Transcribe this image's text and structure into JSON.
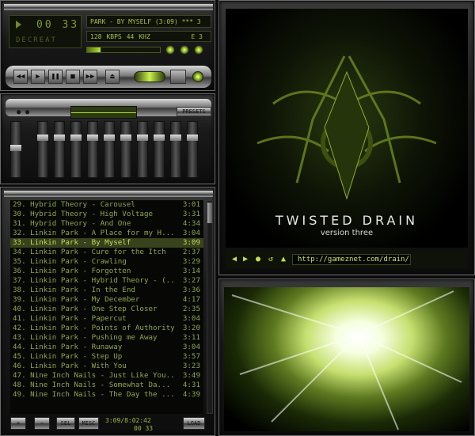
{
  "main_window": {
    "time": "00 33",
    "vis_label": "DECREAT",
    "track_title": "PARK - BY MYSELF (3:09) *** 3",
    "kbps": "128",
    "kbps_unit": "KBPS",
    "khz": "44",
    "khz_unit": "KHZ",
    "mode": "E 3",
    "seek_fraction": 0.18,
    "transport": [
      "◀◀",
      "▶",
      "❚❚",
      "■",
      "▶▶",
      "⏏"
    ]
  },
  "equalizer": {
    "onoff": "● ●",
    "presets_label": "PRESETS",
    "bands": [
      0.45,
      0.25,
      0.25,
      0.25,
      0.25,
      0.25,
      0.25,
      0.25,
      0.25,
      0.25,
      0.25
    ]
  },
  "playlist": {
    "rows": [
      {
        "title": "29. Hybrid Theory - Carousel",
        "dur": "3:01"
      },
      {
        "title": "30. Hybrid Theory - High Voltage",
        "dur": "3:31"
      },
      {
        "title": "31. Hybrid Theory - And One",
        "dur": "4:34"
      },
      {
        "title": "32. Linkin Park - A Place for my H...",
        "dur": "3:04"
      },
      {
        "title": "33. Linkin Park - By Myself",
        "dur": "3:09"
      },
      {
        "title": "34. Linkin Park - Cure for the Itch",
        "dur": "2:37"
      },
      {
        "title": "35. Linkin Park - Crawling",
        "dur": "3:29"
      },
      {
        "title": "36. Linkin Park - Forgotten",
        "dur": "3:14"
      },
      {
        "title": "37. Linkin Park - Hybrid Theory - (...",
        "dur": "3:27"
      },
      {
        "title": "38. Linkin Park - In the End",
        "dur": "3:36"
      },
      {
        "title": "39. Linkin Park - My December",
        "dur": "4:17"
      },
      {
        "title": "40. Linkin Park - One Step Closer",
        "dur": "2:35"
      },
      {
        "title": "41. Linkin Park - Papercut",
        "dur": "3:04"
      },
      {
        "title": "42. Linkin Park - Points of Authority",
        "dur": "3:20"
      },
      {
        "title": "43. Linkin Park - Pushing me Away",
        "dur": "3:11"
      },
      {
        "title": "44. Linkin Park - Runaway",
        "dur": "3:04"
      },
      {
        "title": "45. Linkin Park - Step Up",
        "dur": "3:57"
      },
      {
        "title": "46. Linkin Park - With You",
        "dur": "3:23"
      },
      {
        "title": "47. Nine Inch Nails - Just Like You...",
        "dur": "3:49"
      },
      {
        "title": "48. Nine Inch Nails - Somewhat Da...",
        "dur": "4:31"
      },
      {
        "title": "49. Nine Inch Nails - The Day the ...",
        "dur": "4:39"
      }
    ],
    "selected_index": 4,
    "btn_add": "+",
    "btn_rem": "−",
    "btn_sel": "SEL",
    "btn_misc": "MISC",
    "btn_load": "LOAD",
    "time_info": "3:09/8:02:42",
    "mini_time": "00 33"
  },
  "art_window": {
    "title": "TWISTED DRAIN",
    "subtitle": "version three",
    "url": "http://gameznet.com/drain/",
    "nav_icons": [
      "◀",
      "▶",
      "●",
      "↺",
      "▲"
    ]
  }
}
